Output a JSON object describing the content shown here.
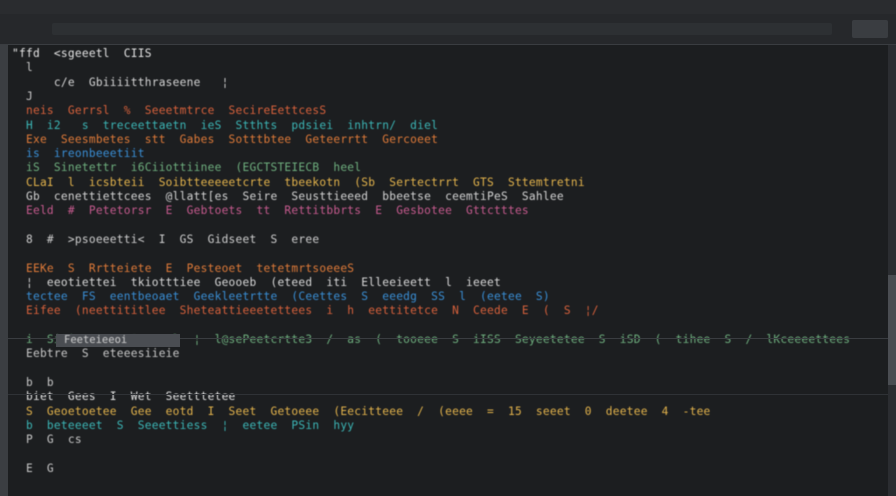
{
  "window": {
    "title": "",
    "tab_label": "",
    "colors": {
      "background": "#1c1e20",
      "titlebar": "#2a2c2f",
      "tabbar": "#26282b",
      "gutter": "#3b3e42",
      "scrollbar": "#2b2d31"
    }
  },
  "editor": {
    "lines": [
      {
        "text": "\"ffd  <sgeeetl  CIIS",
        "color": "#e6e6e6"
      },
      {
        "text": "  l",
        "color": "#c9c9c9"
      },
      {
        "text": "      c/e  Gbiiiitthraseene   ¦",
        "color": "#d6d6d6"
      },
      {
        "text": "  J",
        "color": "#c9c9c9"
      },
      {
        "text": "  neis  Gerrsl  %  Seeetmtrce  SecireEettcesS",
        "color": "#d9623c"
      },
      {
        "text": "  H  i2   s  treceettaetn  ieS  Stthts  pdsiei  inhtrn/  diel  ",
        "color": "#3cb6b6"
      },
      {
        "text": "  Exe  Seesmbetes  stt  Gabes  Sotttbtee  Geteerrtt  Gercoeet",
        "color": "#e07b39"
      },
      {
        "text": "  is  ireonbeeetiit",
        "color": "#3a8fd6"
      },
      {
        "text": "  iS  Sinetettr  i6Ciiottiinee  (EGCTSTEIECB  heel",
        "color": "#6fb07f"
      },
      {
        "text": "  CLaI  l  icsbteii  Soibtteeeeetcrte  tbeekotn  (Sb  Sertectrrt  GTS  Sttemtretni",
        "color": "#e4b44c"
      },
      {
        "text": "  Gb  cenettiettcees  @llatt[es  Seire  Seusttieeed  bbeetse  ceemtiPeS  Sahlee",
        "color": "#d4d4d4"
      },
      {
        "text": "  Eeld  #  Petetorsr  E  Gebtoets  tt  Rettitbbrts  E  Gesbotee  Gttctttes",
        "color": "#c75b8f"
      },
      {
        "text": "",
        "color": "#c9c9c9"
      },
      {
        "text": "  8  #  >psoeeetti<  I  GS  Gidseet  S  eree",
        "color": "#cfcfcf"
      },
      {
        "text": "",
        "color": "#c9c9c9"
      },
      {
        "text": "  EEKe  S  Rrtteiete  E  Pesteoet  tetetmrtsoeeeS",
        "color": "#e07b39"
      },
      {
        "text": "  ¦  eeotiettei  tkiotttiee  Geooeb  (eteed  iti  Elleeieett  l  ieeet",
        "color": "#d9d9d9"
      },
      {
        "text": "  tectee  FS  eentbeoaet  Geekleetrtte  (Ceettes  S  eeedg  SS  l  (eetee  S)",
        "color": "#3a8fd6"
      },
      {
        "text": "  Eifee  (neettititlee  Sheteattieeetettees  i  h  eettitetce  N  Ceede  E  (  S  ¦/",
        "color": "#d9623c"
      },
      {
        "text": "",
        "color": "#c9c9c9"
      },
      {
        "text": "  i  Sitisettee  Secrsel  ¦  l@sePeetcrtte3  /  as  (  tooeee  S  iISS  Seyeetetee  S  iSD  (  tihee  S  /  lKceeeettees",
        "color": "#6fb07f"
      },
      {
        "text": "  Eebtre  S  eteeesiieie",
        "color": "#c9c9c9"
      },
      {
        "text": "",
        "color": "#c9c9c9"
      },
      {
        "text": "  b  b",
        "color": "#c9c9c9"
      },
      {
        "text": "  biet  Gees  I  Wet  Seetttetee",
        "color": "#e6e6e6"
      },
      {
        "text": "  S  Geoetoetee  Gee  eotd  I  Seet  Getoeee  (Eecitteee  /  (eeee  =  15  seeet  0  deetee  4  -tee",
        "color": "#e4b44c"
      },
      {
        "text": "  b  beteeeet  S  Seeettiess  ¦  eetee  PSin  hyy",
        "color": "#3cb6b6"
      },
      {
        "text": "  P  G  cs",
        "color": "#c9c9c9"
      },
      {
        "text": "",
        "color": "#c9c9c9"
      },
      {
        "text": "  E  G",
        "color": "#c9c9c9"
      }
    ],
    "highlighted_line": "Feeteieeoi"
  }
}
